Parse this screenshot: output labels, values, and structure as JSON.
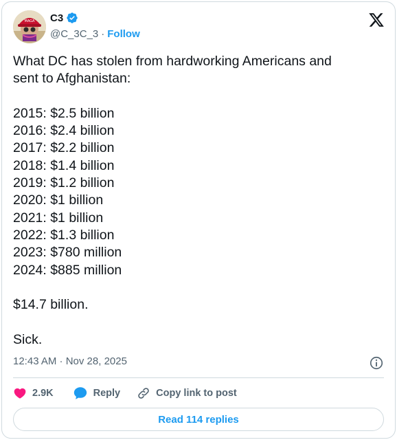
{
  "author": {
    "name": "C3",
    "handle": "@C_3C_3",
    "separator": "·",
    "follow_label": "Follow",
    "verified_color": "#1d9bf0"
  },
  "tweet": {
    "lines": [
      "What DC has stolen from hardworking Americans and",
      "sent to Afghanistan:",
      "",
      "2015: $2.5 billion",
      "2016: $2.4 billion",
      "2017: $2.2 billion",
      "2018: $1.4 billion",
      "2019: $1.2 billion",
      "2020: $1 billion",
      "2021: $1 billion",
      "2022: $1.3 billion",
      "2023: $780 million",
      "2024: $885 million",
      "",
      "$14.7 billion.",
      "",
      "Sick."
    ],
    "timestamp": "12:43 AM · Nov 28, 2025"
  },
  "actions": {
    "likes_count": "2.9K",
    "reply_label": "Reply",
    "copy_link_label": "Copy link to post",
    "read_replies_label": "Read 114 replies"
  },
  "colors": {
    "like": "#f91880",
    "reply": "#1d9bf0",
    "link": "#1d9bf0",
    "text": "#0f1419",
    "muted": "#536471",
    "border": "#cfd9de"
  },
  "icons": [
    "verified-badge-icon",
    "x-logo-icon",
    "info-icon",
    "heart-icon",
    "reply-bubble-icon",
    "link-icon"
  ]
}
